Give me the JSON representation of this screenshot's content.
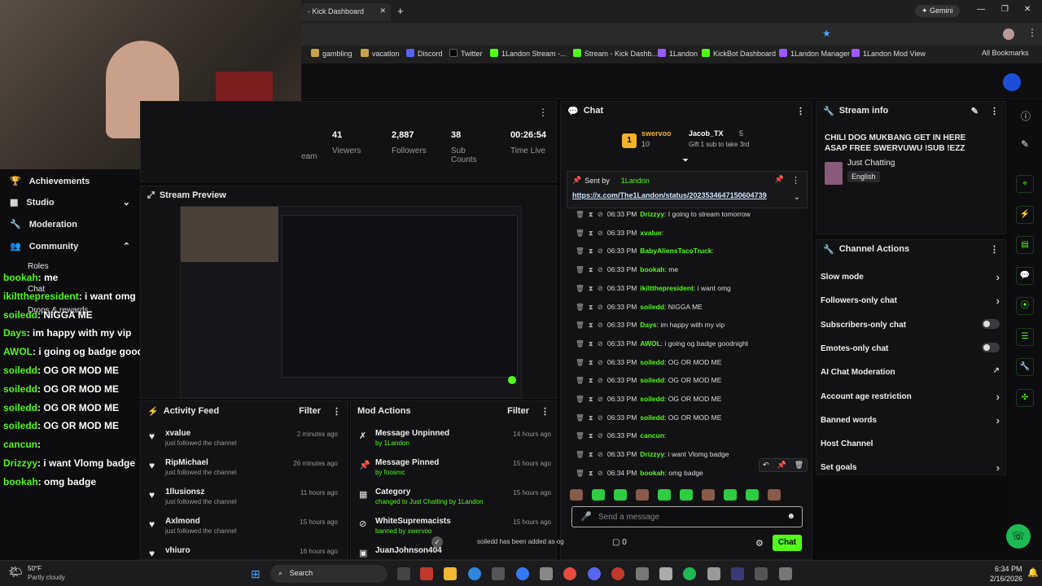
{
  "browser": {
    "tab_title": "- Kick Dashboard",
    "gemini": "Gemini",
    "bookmarks": [
      "gambling",
      "vacation",
      "Discord",
      "Twitter",
      "1Landon Stream -...",
      "Stream - Kick Dashb...",
      "1Landon",
      "KickBot Dashboard",
      "1Landon Manager",
      "1Landon Mod View"
    ],
    "all_bookmarks": "All Bookmarks"
  },
  "stats": [
    {
      "value": "41",
      "label": "Viewers"
    },
    {
      "value": "2,887",
      "label": "Followers"
    },
    {
      "value": "38",
      "label": "Sub Counts"
    },
    {
      "value": "00:26:54",
      "label": "Time Live"
    }
  ],
  "stats_partial": "eam",
  "sidebar": {
    "items": [
      {
        "label": "Achievements"
      },
      {
        "label": "Studio"
      },
      {
        "label": "Moderation"
      },
      {
        "label": "Community"
      }
    ],
    "sub": [
      "Roles",
      "Chat",
      "Drops & rewards"
    ]
  },
  "stream_preview": {
    "title": "Stream Preview"
  },
  "activity": {
    "title": "Activity Feed",
    "filter": "Filter",
    "items": [
      {
        "name": "xvalue",
        "sub": "just followed the channel",
        "ago": "2 minutes ago"
      },
      {
        "name": "RipMichael",
        "sub": "just followed the channel",
        "ago": "26 minutes ago"
      },
      {
        "name": "1llusionsz",
        "sub": "just followed the channel",
        "ago": "11 hours ago"
      },
      {
        "name": "Axlmond",
        "sub": "just followed the channel",
        "ago": "15 hours ago"
      },
      {
        "name": "vhiuro",
        "sub": "",
        "ago": "16 hours ago"
      }
    ]
  },
  "modactions": {
    "title": "Mod Actions",
    "filter": "Filter",
    "items": [
      {
        "title": "Message Unpinned",
        "sub": "by 1Landon",
        "ago": "14 hours ago"
      },
      {
        "title": "Message Pinned",
        "sub": "by foosmc",
        "ago": "15 hours ago"
      },
      {
        "title": "Category",
        "sub": "changed to Just Chatting by 1Landon",
        "ago": "15 hours ago"
      },
      {
        "title": "WhiteSupremacists",
        "sub": "banned by swervoo",
        "ago": "15 hours ago"
      },
      {
        "title": "JuanJohnson404",
        "sub": "",
        "ago": ""
      }
    ]
  },
  "chat": {
    "title": "Chat",
    "top_user": "swervoo",
    "top_count": "10",
    "top_user2": "Jacob_TX",
    "top_count2": "5",
    "gift_text": "Gift 1 sub to take 3rd",
    "pinned_by": "Sent by",
    "pinned_user": "1Landon",
    "pinned_link": "https://x.com/The1Landon/status/2023534647150604739",
    "messages": [
      {
        "time": "06:33 PM",
        "user": "Drizzyy",
        "text": "I going to stream tomorrow"
      },
      {
        "time": "06:33 PM",
        "user": "xvalue",
        "text": ""
      },
      {
        "time": "06:33 PM",
        "user": "BabyAliensTacoTruck",
        "text": ""
      },
      {
        "time": "06:33 PM",
        "user": "bookah",
        "text": "me"
      },
      {
        "time": "06:33 PM",
        "user": "ikiltthepresident",
        "text": "i want omg"
      },
      {
        "time": "06:33 PM",
        "user": "soiledd",
        "text": "NIGGA ME"
      },
      {
        "time": "06:33 PM",
        "user": "Days",
        "text": "im happy with my vip"
      },
      {
        "time": "06:33 PM",
        "user": "AWOL",
        "text": "i going og badge goodnight"
      },
      {
        "time": "06:33 PM",
        "user": "soiledd",
        "text": "OG OR MOD ME"
      },
      {
        "time": "06:33 PM",
        "user": "soiledd",
        "text": "OG OR MOD ME"
      },
      {
        "time": "06:33 PM",
        "user": "soiledd",
        "text": "OG OR MOD ME"
      },
      {
        "time": "06:33 PM",
        "user": "soiledd",
        "text": "OG OR MOD ME"
      },
      {
        "time": "06:33 PM",
        "user": "cancun",
        "text": ""
      },
      {
        "time": "06:33 PM",
        "user": "Drizzyy",
        "text": "i want Vlomg badge"
      },
      {
        "time": "06:34 PM",
        "user": "bookah",
        "text": "omg badge"
      }
    ],
    "placeholder": "Send a message",
    "toast": "soiledd has been added as og",
    "count": "0",
    "send": "Chat"
  },
  "overlay": [
    {
      "user": "bookah",
      "text": "me"
    },
    {
      "user": "ikiltthepresident",
      "text": "i want omg"
    },
    {
      "user": "soiledd",
      "text": "NIGGA ME"
    },
    {
      "user": "Days",
      "text": "im happy with my vip"
    },
    {
      "user": "AWOL",
      "text": "i going og badge goodnight"
    },
    {
      "user": "soiledd",
      "text": "OG OR MOD ME"
    },
    {
      "user": "soiledd",
      "text": "OG OR MOD ME"
    },
    {
      "user": "soiledd",
      "text": "OG OR MOD ME"
    },
    {
      "user": "soiledd",
      "text": "OG OR MOD ME"
    },
    {
      "user": "cancun",
      "text": ""
    },
    {
      "user": "Drizzyy",
      "text": "i want Vlomg badge"
    },
    {
      "user": "bookah",
      "text": "omg badge"
    }
  ],
  "streaminfo": {
    "title": "Stream info",
    "stream_title": "CHILI DOG MUKBANG GET IN HERE ASAP FREE SWERVUWU !SUB !EZZ",
    "category": "Just Chatting",
    "language": "English"
  },
  "channel_actions": {
    "title": "Channel Actions",
    "items": [
      "Slow mode",
      "Followers-only chat",
      "Subscribers-only chat",
      "Emotes-only chat",
      "AI Chat Moderation",
      "Account age restriction",
      "Banned words",
      "Host Channel",
      "Set goals"
    ]
  },
  "taskbar": {
    "weather_temp": "50°F",
    "weather_desc": "Partly cloudy",
    "search": "Search",
    "time": "6:34 PM",
    "date": "2/16/2026"
  }
}
